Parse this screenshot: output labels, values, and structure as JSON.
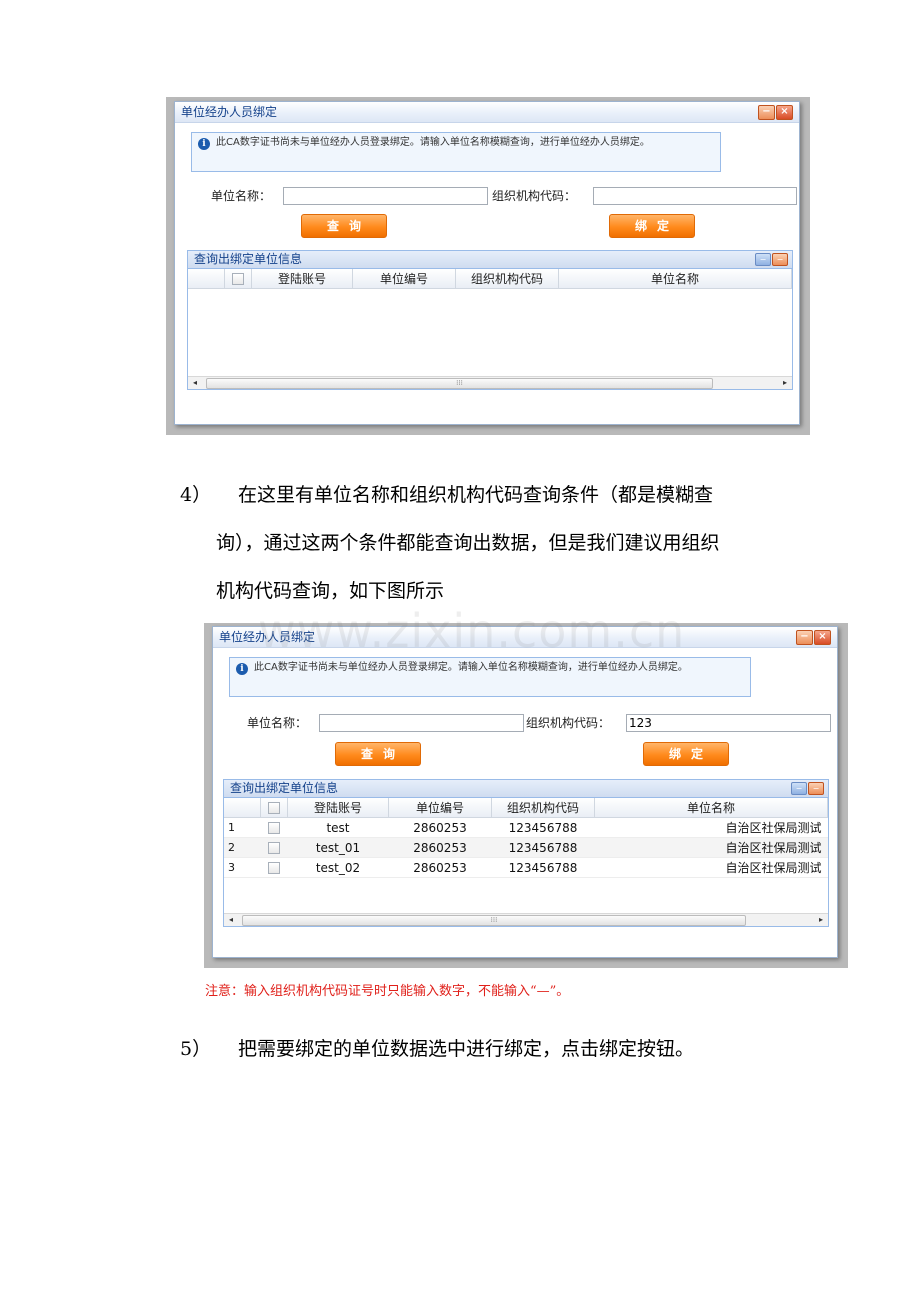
{
  "dialog": {
    "title": "单位经办人员绑定",
    "minimize_glyph": "−",
    "close_glyph": "×",
    "info_icon": "i",
    "info_text": "此CA数字证书尚未与单位经办人员登录绑定。请输入单位名称模糊查询，进行单位经办人员绑定。",
    "unit_name_label": "单位名称：",
    "org_code_label": "组织机构代码：",
    "query_button": "查询",
    "bind_button": "绑定",
    "panel_title": "查询出绑定单位信息",
    "panel_glyph": "−",
    "columns": [
      "登陆账号",
      "单位编号",
      "组织机构代码",
      "单位名称"
    ],
    "scroll_left": "◂",
    "scroll_right": "▸",
    "scroll_thumb": "⁞⁞⁞"
  },
  "shot1": {
    "unit_name_value": "",
    "org_code_value": ""
  },
  "shot2": {
    "unit_name_value": "",
    "org_code_value": "123",
    "rows": [
      {
        "num": "1",
        "account": "test",
        "unit_no": "2860253",
        "org_code": "123456788",
        "unit_name": "自治区社保局测试"
      },
      {
        "num": "2",
        "account": "test_01",
        "unit_no": "2860253",
        "org_code": "123456788",
        "unit_name": "自治区社保局测试"
      },
      {
        "num": "3",
        "account": "test_02",
        "unit_no": "2860253",
        "org_code": "123456788",
        "unit_name": "自治区社保局测试"
      }
    ]
  },
  "doc": {
    "step4_num": "4）",
    "step4_line1": "在这里有单位名称和组织机构代码查询条件（都是模糊查",
    "step4_line2": "询），通过这两个条件都能查询出数据，但是我们建议用组织",
    "step4_line3": "机构代码查询，如下图所示",
    "watermark": "www.zixin.com.cn",
    "note": "注意：输入组织机构代码证号时只能输入数字，不能输入“—”。",
    "step5_num": "5）",
    "step5_text": "把需要绑定的单位数据选中进行绑定，点击绑定按钮。"
  }
}
